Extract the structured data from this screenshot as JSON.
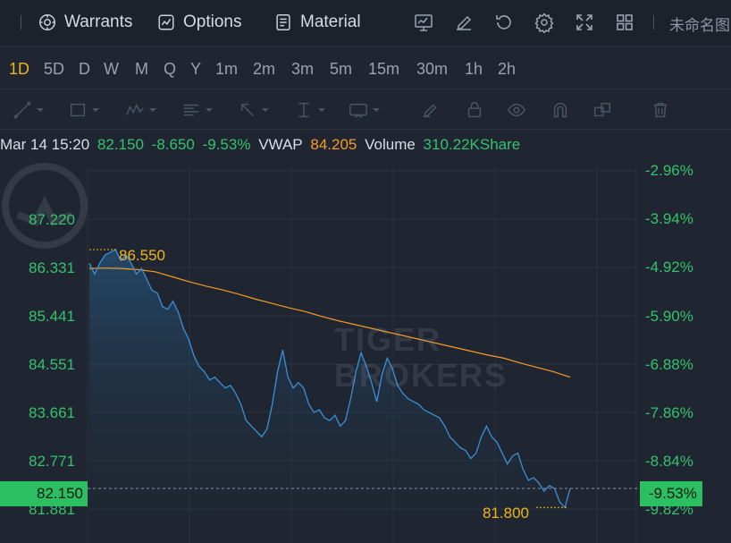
{
  "topbar": {
    "tabs": [
      {
        "label": "Warrants",
        "icon": "warrants-icon"
      },
      {
        "label": "Options",
        "icon": "options-icon"
      },
      {
        "label": "Material",
        "icon": "material-icon"
      }
    ],
    "tools": [
      "chart-settings-icon",
      "edit-icon",
      "reset-icon",
      "gear-icon",
      "fullscreen-icon",
      "grid-layout-icon"
    ],
    "account_label": "未命名图"
  },
  "periods": {
    "items": [
      "1D",
      "5D",
      "D",
      "W",
      "M",
      "Q",
      "Y",
      "1m",
      "2m",
      "3m",
      "5m",
      "15m",
      "30m",
      "1h",
      "2h"
    ],
    "active": "1D"
  },
  "drawing_tools": [
    "line-tool-icon",
    "rectangle-tool-icon",
    "pattern-tool-icon",
    "fibonacci-tool-icon",
    "arrow-tool-icon",
    "measure-tool-icon",
    "text-tool-icon",
    "brush-icon",
    "lock-icon",
    "eye-icon",
    "magnet-icon",
    "layers-icon",
    "trash-icon"
  ],
  "info": {
    "datetime": "Mar 14 15:20",
    "price": "82.150",
    "change": "-8.650",
    "change_pct": "-9.53%",
    "vwap_label": "VWAP",
    "vwap": "84.205",
    "volume_label": "Volume",
    "volume": "310.22KShare"
  },
  "colors": {
    "up_down_green": "#33c26b",
    "vwap_orange": "#f59a23",
    "price_line": "#3b8fd6",
    "highlight_yellow": "#f0b41a",
    "background": "#1f2631"
  },
  "chart_data": {
    "type": "line",
    "y_left_ticks": [
      "87.220",
      "86.331",
      "85.441",
      "84.551",
      "83.661",
      "82.771",
      "81.881"
    ],
    "y_right_ticks": [
      "-2.96%",
      "-3.94%",
      "-4.92%",
      "-5.90%",
      "-6.88%",
      "-7.86%",
      "-8.84%",
      "-9.82%"
    ],
    "current_price_tag": "82.150",
    "current_pct_tag": "-9.53%",
    "high_label": "86.550",
    "low_label": "81.800",
    "ylim": [
      81.6,
      87.9
    ],
    "series": [
      {
        "name": "Price",
        "values": [
          86.3,
          86.1,
          86.3,
          86.45,
          86.5,
          86.55,
          86.35,
          86.45,
          86.3,
          86.1,
          86.2,
          86.0,
          85.8,
          85.75,
          85.5,
          85.45,
          85.6,
          85.4,
          85.1,
          84.9,
          84.6,
          84.4,
          84.3,
          84.15,
          84.2,
          84.1,
          84.0,
          84.05,
          83.9,
          83.7,
          83.4,
          83.3,
          83.2,
          83.1,
          83.25,
          83.7,
          84.3,
          84.7,
          84.2,
          84.0,
          84.1,
          84.0,
          83.7,
          83.55,
          83.6,
          83.45,
          83.4,
          83.5,
          83.3,
          83.4,
          83.8,
          84.3,
          84.65,
          84.4,
          84.1,
          83.75,
          84.25,
          84.55,
          84.35,
          84.05,
          83.9,
          83.8,
          83.75,
          83.7,
          83.6,
          83.55,
          83.5,
          83.45,
          83.3,
          83.1,
          83.0,
          82.9,
          82.85,
          82.7,
          82.8,
          83.1,
          83.3,
          83.1,
          83.0,
          82.8,
          82.6,
          82.75,
          82.8,
          82.5,
          82.3,
          82.35,
          82.25,
          82.1,
          82.2,
          82.15,
          81.9,
          81.8,
          82.15
        ],
        "color": "#3b8fd6"
      },
      {
        "name": "VWAP",
        "values": [
          86.2,
          86.21,
          86.2,
          86.18,
          86.14,
          86.05,
          85.96,
          85.88,
          85.81,
          85.73,
          85.64,
          85.56,
          85.48,
          85.41,
          85.32,
          85.24,
          85.17,
          85.1,
          85.03,
          84.96,
          84.89,
          84.82,
          84.75,
          84.68,
          84.61,
          84.55,
          84.46,
          84.38,
          84.3,
          84.2
        ],
        "color": "#f59a23"
      }
    ]
  }
}
